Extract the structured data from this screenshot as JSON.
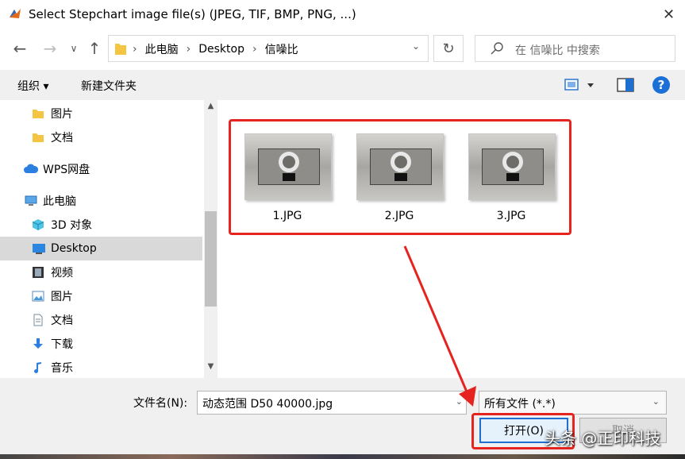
{
  "window": {
    "title": "Select Stepchart image file(s) (JPEG, TIF, BMP, PNG, ...)",
    "close_glyph": "✕"
  },
  "nav": {
    "back_glyph": "←",
    "forward_glyph": "→",
    "history_glyph": "∨",
    "up_glyph": "↑",
    "refresh_glyph": "↻",
    "breadcrumb": [
      "此电脑",
      "Desktop",
      "信噪比"
    ],
    "breadcrumb_sep": "›",
    "search_placeholder": "在 信噪比 中搜索"
  },
  "toolbar": {
    "organize_label": "组织 ▾",
    "new_folder_label": "新建文件夹",
    "help_label": "?"
  },
  "sidebar": {
    "items": [
      {
        "label": "图片",
        "icon": "folder-icon",
        "indent": 2
      },
      {
        "label": "文档",
        "icon": "folder-icon",
        "indent": 2
      },
      {
        "label": "WPS网盘",
        "icon": "cloud-icon",
        "indent": 1
      },
      {
        "label": "此电脑",
        "icon": "computer-icon",
        "indent": 1
      },
      {
        "label": "3D 对象",
        "icon": "cube-icon",
        "indent": 2
      },
      {
        "label": "Desktop",
        "icon": "desktop-icon",
        "indent": 2,
        "selected": true
      },
      {
        "label": "视频",
        "icon": "video-icon",
        "indent": 2
      },
      {
        "label": "图片",
        "icon": "picture-icon",
        "indent": 2
      },
      {
        "label": "文档",
        "icon": "document-icon",
        "indent": 2
      },
      {
        "label": "下载",
        "icon": "download-icon",
        "indent": 2
      },
      {
        "label": "音乐",
        "icon": "music-icon",
        "indent": 2
      }
    ]
  },
  "files": [
    {
      "name": "1.JPG"
    },
    {
      "name": "2.JPG"
    },
    {
      "name": "3.JPG"
    }
  ],
  "footer": {
    "filename_label": "文件名(N):",
    "filename_value": "动态范围 D50 40000.jpg",
    "filetype_value": "所有文件 (*.*)",
    "open_label": "打开(O)",
    "cancel_label": "取消",
    "dropdown_glyph": "⌄"
  },
  "watermark": "头条 @正印科技",
  "colors": {
    "highlight": "#e52420",
    "accent": "#1f6fd1",
    "selected_bg": "#d9d9d9"
  }
}
